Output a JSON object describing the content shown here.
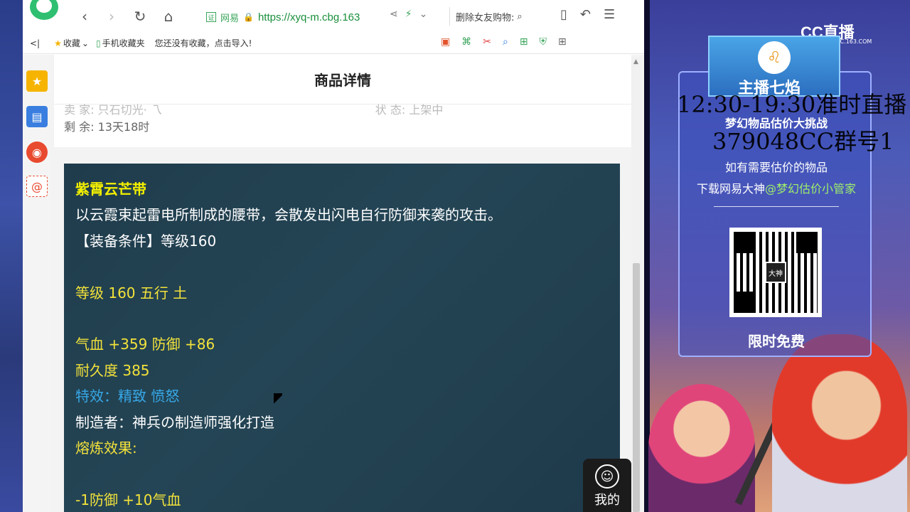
{
  "browser": {
    "address": {
      "cert_badge": "证",
      "site_label": "网易",
      "url": "https://xyq-m.cbg.163"
    },
    "search": {
      "text": "删除女友购物:"
    },
    "bookmarks": {
      "collapse": "<|",
      "favorites_label": "收藏",
      "mobile_label": "手机收藏夹",
      "import_hint": "您还没有收藏，点击导入!"
    }
  },
  "page": {
    "header_title": "商品详情",
    "info_partial_left": "卖 家: 只石切光· 乁",
    "info_partial_right": "状 态: 上架中",
    "remaining": "剩 余: 13天18时"
  },
  "item": {
    "name": "紫霄云芒带",
    "description": "以云霞束起雷电所制成的腰带，会散发出闪电自行防御来袭的攻击。",
    "requirement": "【装备条件】等级160",
    "level_element": "等级 160 五行 土",
    "stats": "气血 +359 防御 +86",
    "durability": "耐久度 385",
    "special": "特效：精致 愤怒",
    "maker": "制造者：神兵の制造师强化打造",
    "refine_label": "熔炼效果:",
    "refine_value": "-1防御 +10气血"
  },
  "mine_button": {
    "label": "我的"
  },
  "stream": {
    "platform": "CC直播",
    "platform_sub": "CC.163.COM",
    "host_name": "主播七焰",
    "schedule": "12:30-19:30准时直播",
    "event_title": "梦幻物品估价大挑战",
    "group": "379048CC群号1",
    "need_text": "如有需要估价的物品",
    "download_text": "下载网易大神",
    "mention": "@梦幻估价小管家",
    "qr_center": "大神",
    "free_label": "限时免费"
  },
  "colors": {
    "panel_bg": "#1f3c4c",
    "item_name": "#f3f000",
    "special_text": "#37a8e8",
    "url_green": "#1a8f3c"
  }
}
